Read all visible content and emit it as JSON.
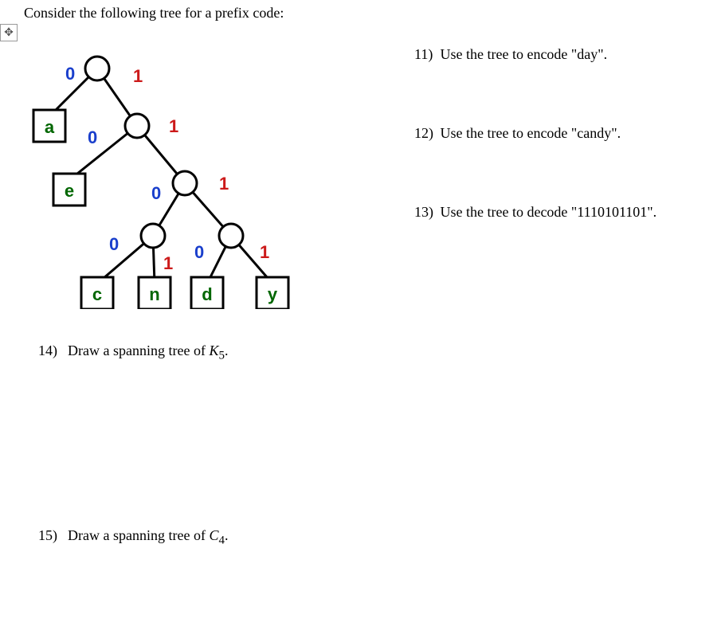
{
  "prompt": "Consider the following tree for a prefix code:",
  "questions": {
    "q11": {
      "num": "11)",
      "text": "Use the tree to encode \"day\"."
    },
    "q12": {
      "num": "12)",
      "text": "Use the tree to encode \"candy\"."
    },
    "q13": {
      "num": "13)",
      "text": "Use the tree to decode \"1110101101\"."
    },
    "q14": {
      "num": "14)",
      "text_before": "Draw a spanning tree of ",
      "graph_letter": "K",
      "graph_sub": "5",
      "after": "."
    },
    "q15": {
      "num": "15)",
      "text_before": "Draw a spanning tree of ",
      "graph_letter": "C",
      "graph_sub": "4",
      "after": "."
    }
  },
  "tree": {
    "leaves": {
      "a": "a",
      "e": "e",
      "c": "c",
      "n": "n",
      "d": "d",
      "y": "y"
    },
    "labels": {
      "root_left": "0",
      "root_right": "1",
      "l2_left": "0",
      "l2_right": "1",
      "l3_left": "0",
      "l3_right": "1",
      "l4a_left": "0",
      "l4a_right": "1",
      "l4b_left": "0",
      "l4b_right": "1"
    }
  },
  "handle_glyph": "✥"
}
